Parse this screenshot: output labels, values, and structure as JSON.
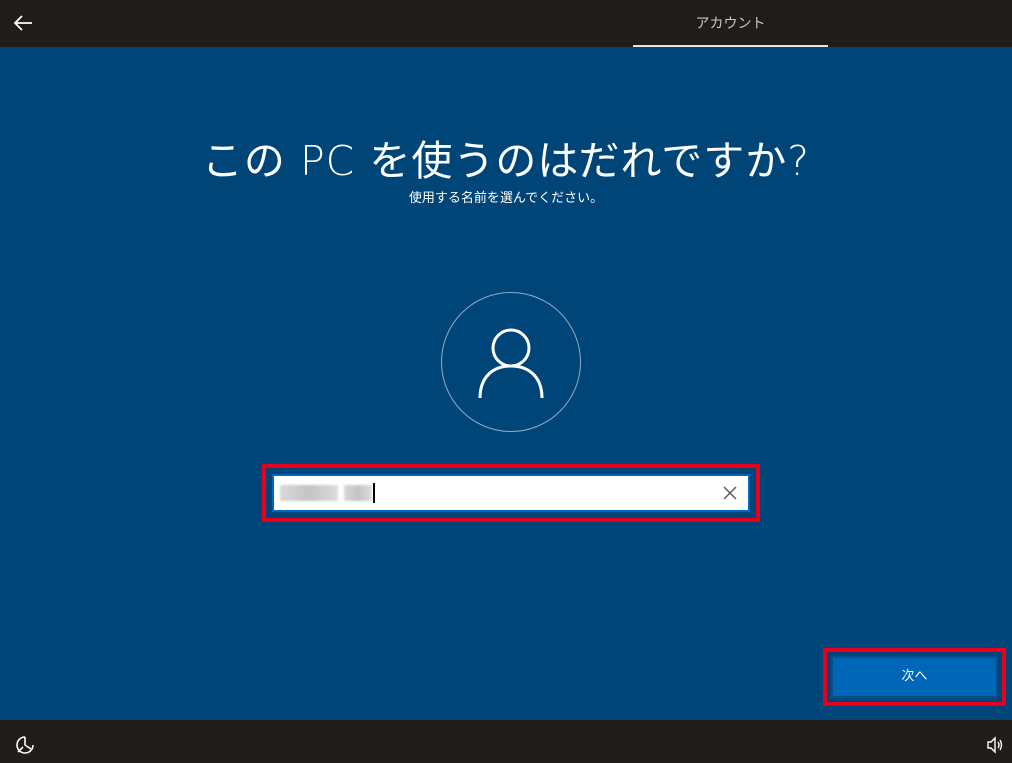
{
  "header": {
    "tab_label": "アカウント",
    "back_icon": "back-arrow-icon"
  },
  "main": {
    "title": "この PC を使うのはだれですか?",
    "subtitle": "使用する名前を選んでください。",
    "avatar_icon": "user-icon",
    "name_field": {
      "value": "",
      "value_obscured": true,
      "clear_icon": "close-icon"
    },
    "next_label": "次へ"
  },
  "footer": {
    "accessibility_icon": "ease-of-access-icon",
    "volume_icon": "volume-icon"
  },
  "colors": {
    "chrome": "#1f1c1a",
    "background": "#004578",
    "button": "#0067b8",
    "highlight": "#e8001c"
  }
}
